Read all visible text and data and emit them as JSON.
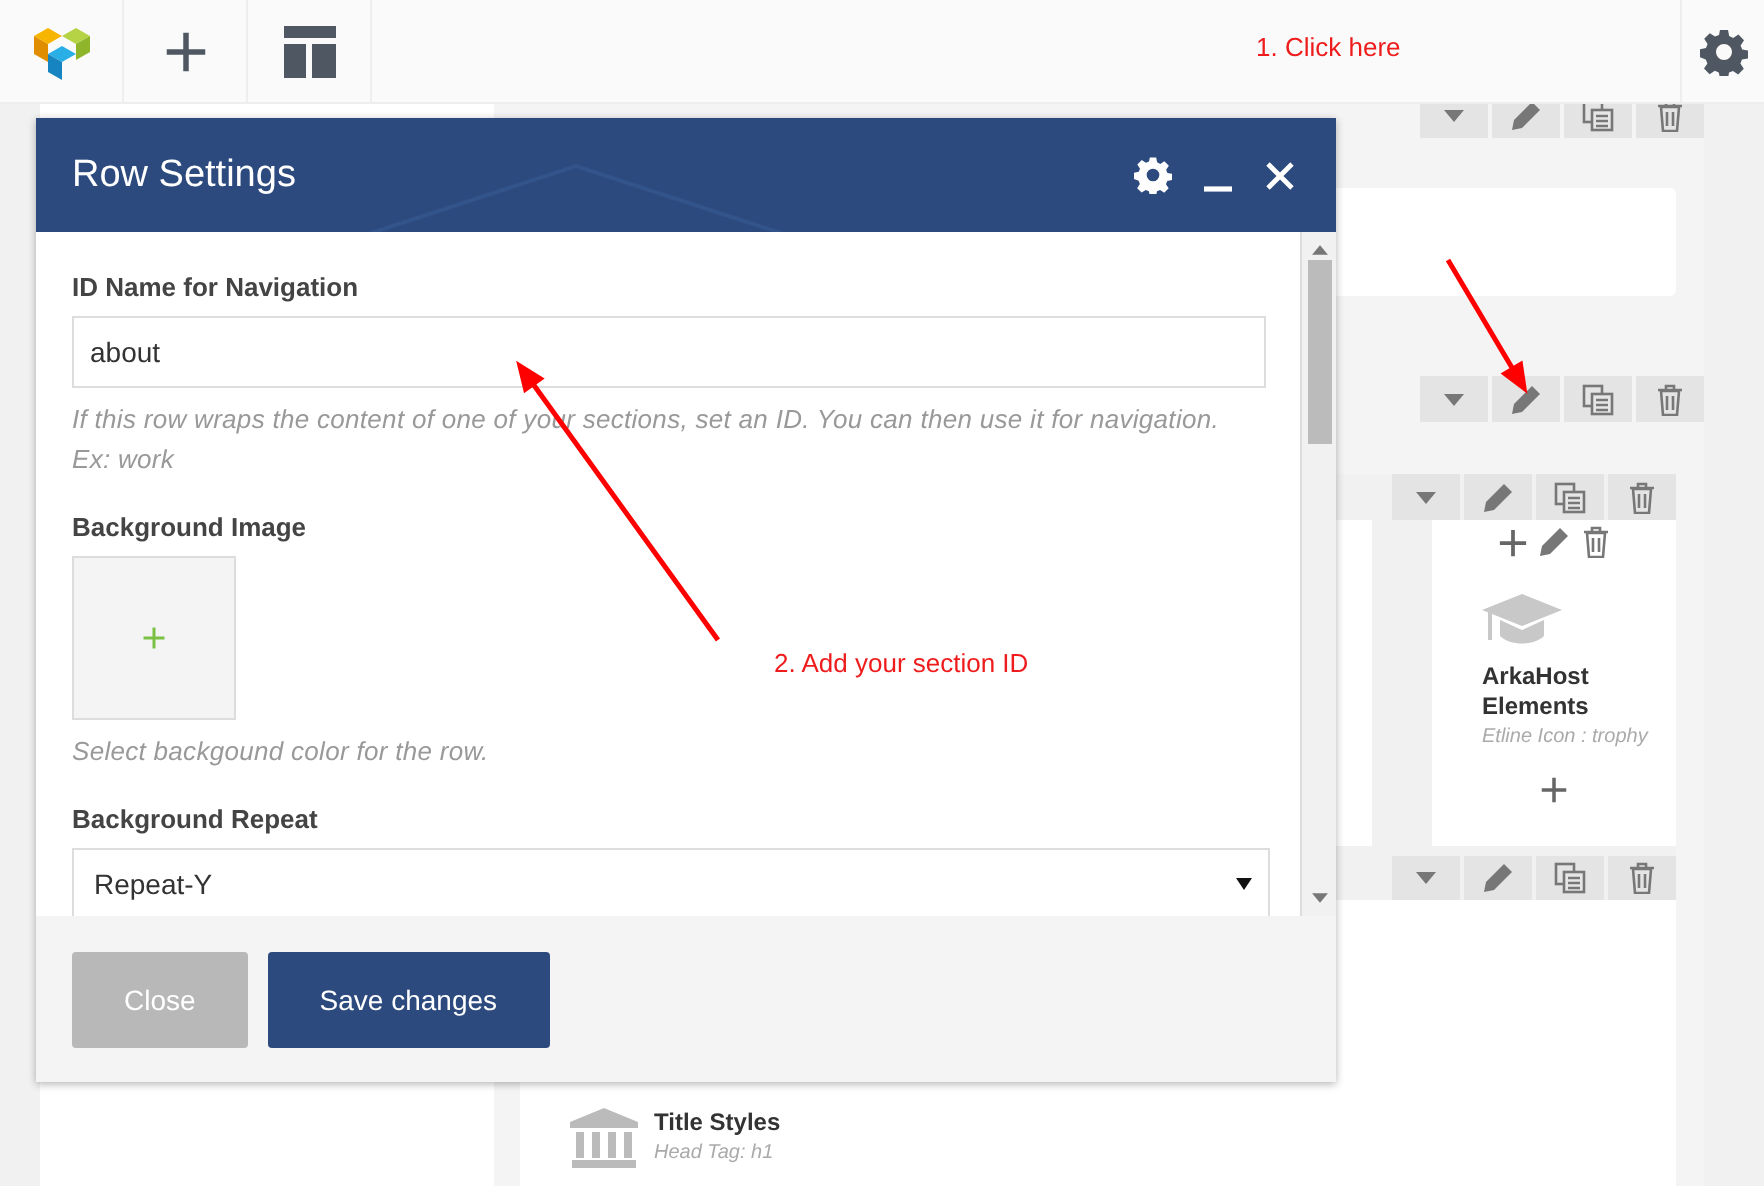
{
  "modal": {
    "title": "Row Settings",
    "fields": [
      {
        "kind": "text",
        "label": "ID Name for Navigation",
        "value": "about",
        "help": "If this row wraps the content of one of your sections, set an ID. You can then use it for navigation. Ex: work"
      },
      {
        "kind": "image",
        "label": "Background Image",
        "help": "Select backgound color for the row."
      },
      {
        "kind": "select",
        "label": "Background Repeat",
        "value": "Repeat-Y"
      }
    ],
    "buttons": [
      {
        "label": "Close",
        "kind": "secondary"
      },
      {
        "label": "Save changes",
        "kind": "primary"
      }
    ]
  },
  "builder": {
    "elements": [
      {
        "title": "ArkaHost Elements",
        "subtitle": "Etline Icon : trophy"
      },
      {
        "title": "Title Styles",
        "subtitle": "Head Tag: h1"
      }
    ]
  },
  "annotations": [
    {
      "text": "1. Click here"
    },
    {
      "text": "2. Add your section ID"
    }
  ]
}
